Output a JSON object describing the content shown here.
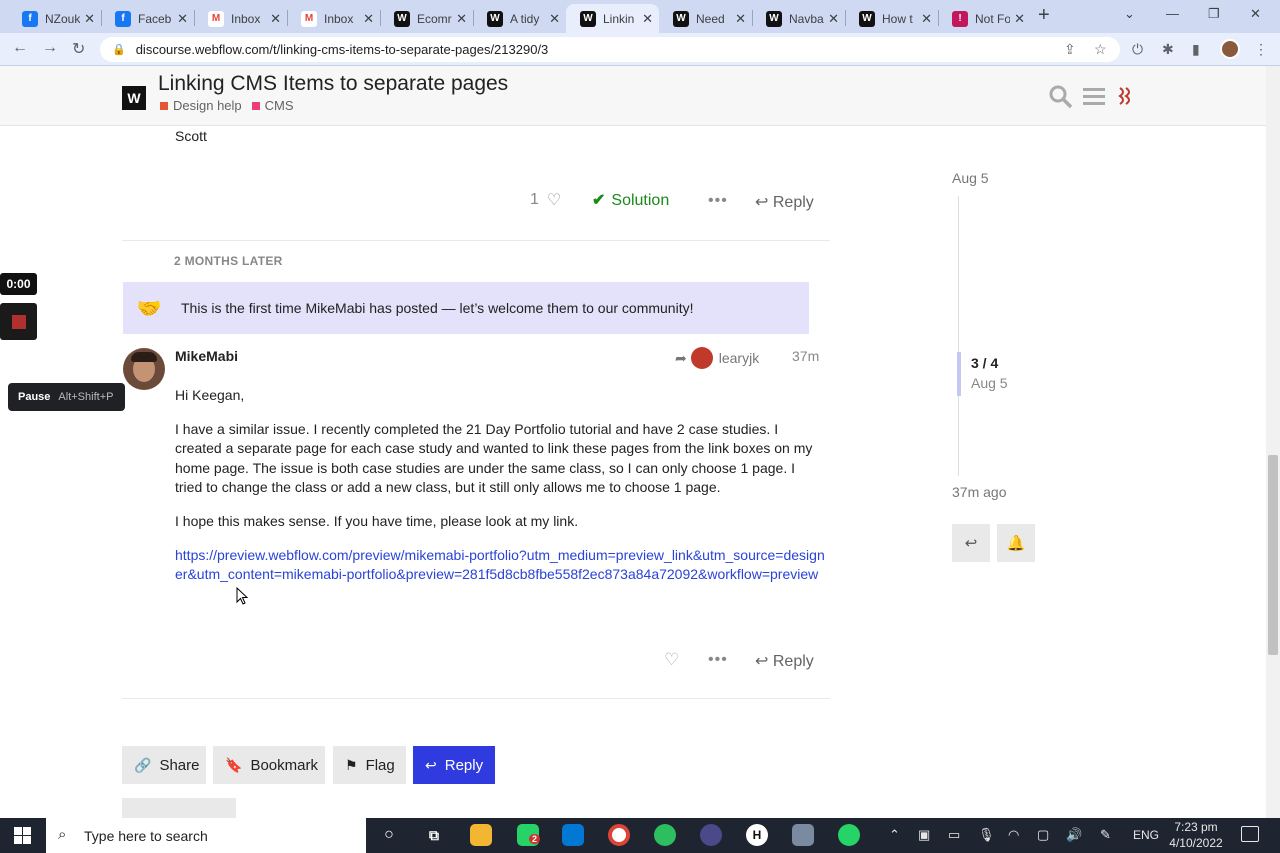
{
  "browser": {
    "tabs": [
      {
        "label": "NZouk",
        "icon": "facebook-icon",
        "color": "#1877f2",
        "glyph": "f"
      },
      {
        "label": "Faceb",
        "icon": "facebook-icon",
        "color": "#1877f2",
        "glyph": "f"
      },
      {
        "label": "Inbox",
        "icon": "gmail-icon",
        "color": "#ea4335",
        "glyph": "M"
      },
      {
        "label": "Inbox",
        "icon": "gmail-icon",
        "color": "#ea4335",
        "glyph": "M"
      },
      {
        "label": "Ecomr",
        "icon": "webflow-icon",
        "color": "#111111",
        "glyph": "W"
      },
      {
        "label": "A tidy",
        "icon": "webflow-icon",
        "color": "#111111",
        "glyph": "W"
      },
      {
        "label": "Linkin",
        "icon": "webflow-icon",
        "color": "#111111",
        "glyph": "W"
      },
      {
        "label": "Need",
        "icon": "webflow-icon",
        "color": "#111111",
        "glyph": "W"
      },
      {
        "label": "Navba",
        "icon": "webflow-icon",
        "color": "#111111",
        "glyph": "W"
      },
      {
        "label": "How t",
        "icon": "webflow-icon",
        "color": "#111111",
        "glyph": "W"
      },
      {
        "label": "Not Fo",
        "icon": "cms-icon",
        "color": "#c2185b",
        "glyph": "!"
      }
    ],
    "active_tab_index": 6,
    "url": "discourse.webflow.com/t/linking-cms-items-to-separate-pages/213290/3"
  },
  "header": {
    "title": "Linking CMS Items to separate pages",
    "categories": [
      "Design help",
      "CMS"
    ],
    "logo": "W"
  },
  "previous_post": {
    "signature": "Scott",
    "like_count": "1",
    "solution_label": "Solution",
    "reply_label": "Reply"
  },
  "time_gap": "2 MONTHS LATER",
  "welcome_notice": "This is the first time MikeMabi has posted — let’s welcome them to our community!",
  "post": {
    "username": "MikeMabi",
    "reply_to_user": "learyjk",
    "age": "37m",
    "paragraphs": [
      "Hi Keegan,",
      "I have a similar issue. I recently completed the 21 Day Portfolio tutorial and have 2 case studies. I created a separate page for each case study and wanted to link these pages from the link boxes on my home page. The issue is both case studies are under the same class, so I can only choose 1 page. I tried to change the class or add a new class, but it still only allows me to choose 1 page.",
      "I hope this makes sense. If you have time, please look at my link."
    ],
    "link": "https://preview.webflow.com/preview/mikemabi-portfolio?utm_medium=preview_link&utm_source=designer&utm_content=mikemabi-portfolio&preview=281f5d8cb8fbe558f2ec873a84a72092&workflow=preview",
    "reply_label": "Reply"
  },
  "footer_buttons": {
    "share": "Share",
    "bookmark": "Bookmark",
    "flag": "Flag",
    "reply": "Reply"
  },
  "timeline": {
    "top_date": "Aug 5",
    "position": "3 / 4",
    "position_date": "Aug 5",
    "bottom_label": "37m ago"
  },
  "recorder": {
    "time": "0:00",
    "tooltip_action": "Pause",
    "tooltip_shortcut": "Alt+Shift+P"
  },
  "taskbar": {
    "search_placeholder": "Type here to search",
    "language": "ENG",
    "time": "7:23 pm",
    "date": "4/10/2022",
    "whatsapp_badge": "2"
  },
  "colors": {
    "accent": "#2f3bde",
    "solution_green": "#1a8a1a",
    "welcome_bg": "#e3e2fa"
  }
}
